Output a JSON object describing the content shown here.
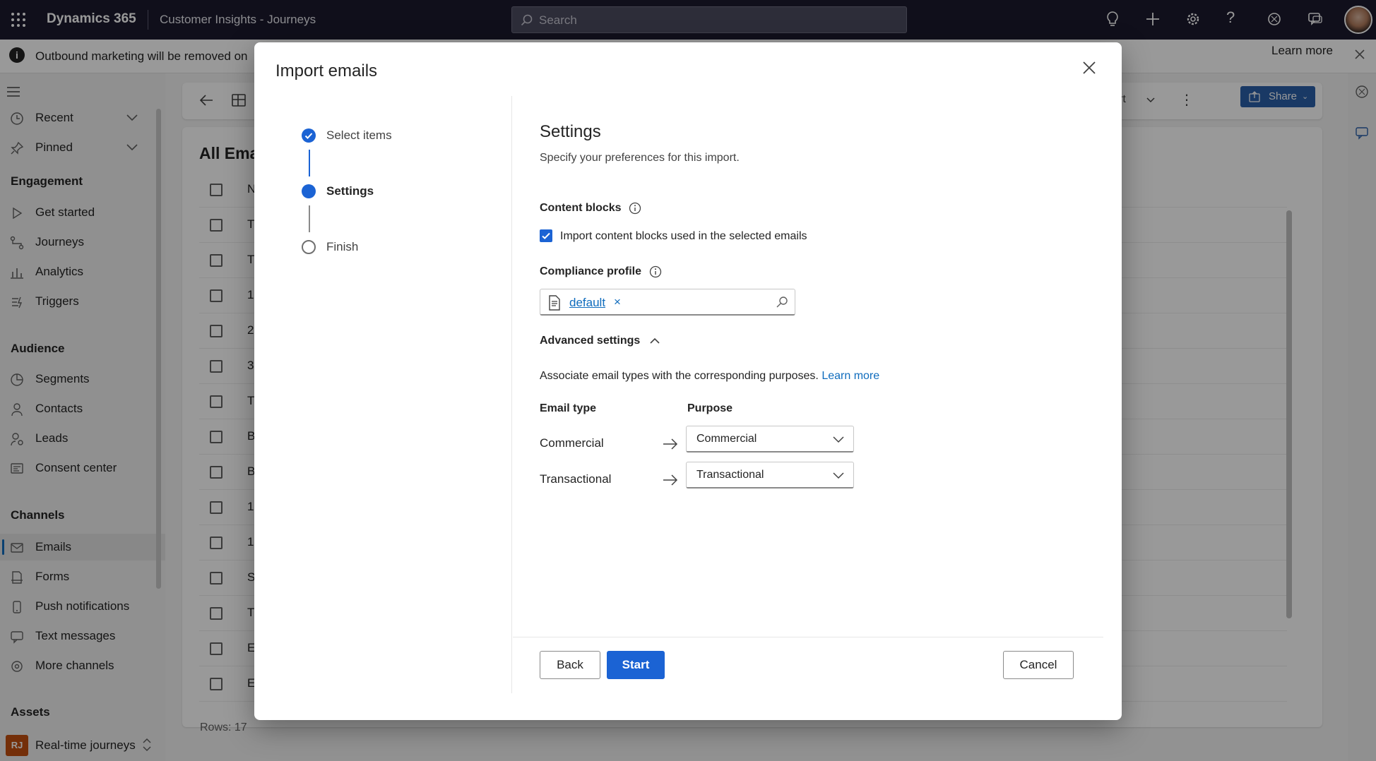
{
  "topbar": {
    "brand": "Dynamics 365",
    "app_name": "Customer Insights - Journeys",
    "search_placeholder": "Search"
  },
  "notice": {
    "text": "Outbound marketing will be removed on",
    "learn_more": "Learn more"
  },
  "sidebar": {
    "recent": "Recent",
    "pinned": "Pinned",
    "sections": {
      "engagement": "Engagement",
      "audience": "Audience",
      "channels": "Channels",
      "assets": "Assets"
    },
    "engagement_items": [
      "Get started",
      "Journeys",
      "Analytics",
      "Triggers"
    ],
    "audience_items": [
      "Segments",
      "Contacts",
      "Leads",
      "Consent center"
    ],
    "channel_items": [
      "Emails",
      "Forms",
      "Push notifications",
      "Text messages",
      "More channels"
    ],
    "area": {
      "badge": "RJ",
      "label": "Real-time journeys"
    }
  },
  "main": {
    "list_title": "All Ema",
    "share_label": "Share",
    "toolbar_partial": "rt",
    "rows_count": "Rows: 17",
    "row_first_chars": [
      "N",
      "T",
      "T",
      "1",
      "2",
      "3",
      "T",
      "B",
      "B",
      "1",
      "1",
      "S",
      "T",
      "E",
      "E"
    ]
  },
  "dialog": {
    "title": "Import emails",
    "steps": [
      {
        "label": "Select items",
        "state": "done"
      },
      {
        "label": "Settings",
        "state": "current"
      },
      {
        "label": "Finish",
        "state": "todo"
      }
    ],
    "settings": {
      "heading": "Settings",
      "subtitle": "Specify your preferences for this import.",
      "content_blocks_label": "Content blocks",
      "content_blocks_checkbox": "Import content blocks used in the selected emails",
      "content_blocks_checked": true,
      "compliance_label": "Compliance profile",
      "compliance_value": "default",
      "advanced_label": "Advanced settings",
      "associate_text": "Associate email types with the corresponding purposes.",
      "associate_link": "Learn more",
      "col_email_type": "Email type",
      "col_purpose": "Purpose",
      "mappings": [
        {
          "type": "Commercial",
          "purpose": "Commercial"
        },
        {
          "type": "Transactional",
          "purpose": "Transactional"
        }
      ]
    },
    "buttons": {
      "back": "Back",
      "start": "Start",
      "cancel": "Cancel"
    }
  },
  "colors": {
    "accent": "#1b63d4",
    "topbar": "#1b1a2e",
    "link": "#0f6cbd"
  }
}
